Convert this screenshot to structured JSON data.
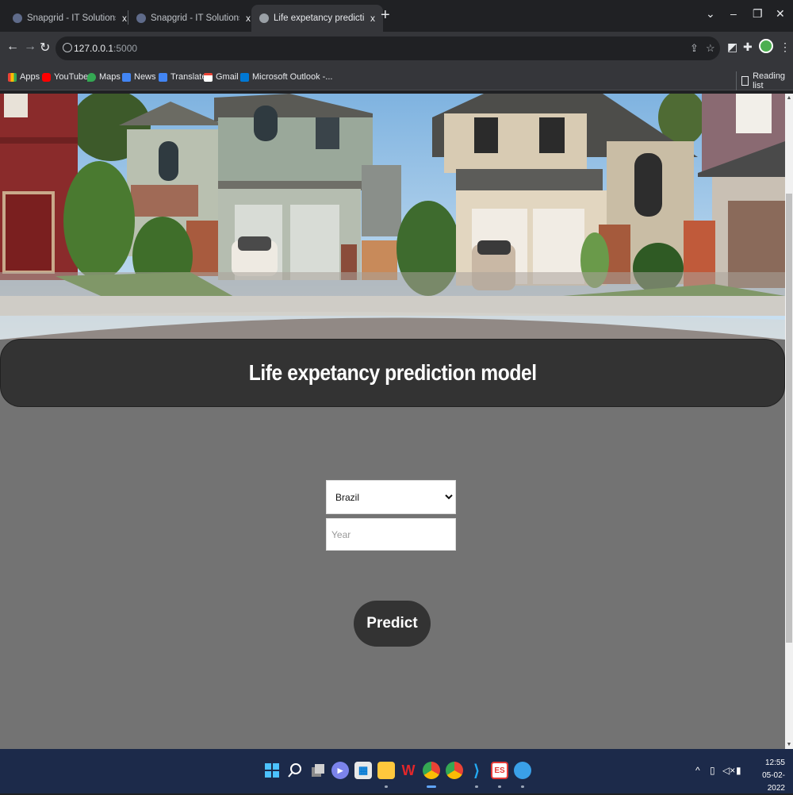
{
  "browser": {
    "tabs": [
      {
        "title": "Snapgrid - IT Solutions and Technology"
      },
      {
        "title": "Snapgrid - IT Solutions and Technology"
      },
      {
        "title": "Life expetancy prediction model"
      }
    ],
    "new_tab_label": "+",
    "close_glyph": "x",
    "url_host": "127.0.0.1",
    "url_port": ":5000",
    "bookmarks": [
      {
        "label": "Apps",
        "icon": "apps-grid-icon",
        "color": "#ea4335"
      },
      {
        "label": "YouTube",
        "icon": "youtube-icon",
        "color": "#ff0000"
      },
      {
        "label": "Maps",
        "icon": "maps-pin-icon",
        "color": "#34a853"
      },
      {
        "label": "News",
        "icon": "news-icon",
        "color": "#4285f4"
      },
      {
        "label": "Translate",
        "icon": "translate-icon",
        "color": "#4285f4"
      },
      {
        "label": "Gmail",
        "icon": "gmail-icon",
        "color": "#ea4335"
      },
      {
        "label": "Microsoft Outlook -...",
        "icon": "outlook-icon",
        "color": "#0078d4"
      }
    ],
    "reading_list": "Reading list"
  },
  "page": {
    "header_title": "Life expetancy prediction model",
    "country_select": {
      "selected": "Brazil",
      "options": [
        "Brazil"
      ]
    },
    "year_input": {
      "placeholder": "Year",
      "value": ""
    },
    "predict_label": "Predict"
  },
  "taskbar": {
    "clock_time": "12:55",
    "clock_date": "05-02-2022",
    "apps": [
      {
        "icon": "windows-start-icon",
        "color": "#4cc2ff"
      },
      {
        "icon": "search-icon",
        "color": "#ffffff"
      },
      {
        "icon": "task-view-icon",
        "color": "#cfcfcf"
      },
      {
        "icon": "teams-chat-icon",
        "color": "#7b83eb"
      },
      {
        "icon": "store-icon",
        "color": "#f3f3f3"
      },
      {
        "icon": "file-explorer-icon",
        "color": "#ffc83d"
      },
      {
        "icon": "wps-office-icon",
        "color": "#e3262a"
      },
      {
        "icon": "chrome-icon",
        "color": "#34a853"
      },
      {
        "icon": "chrome-icon",
        "color": "#fbbc05"
      },
      {
        "icon": "vscode-icon",
        "color": "#23a9f2"
      },
      {
        "icon": "app-icon",
        "color": "#e53935"
      },
      {
        "icon": "globe-icon",
        "color": "#3aa0e8"
      }
    ]
  }
}
